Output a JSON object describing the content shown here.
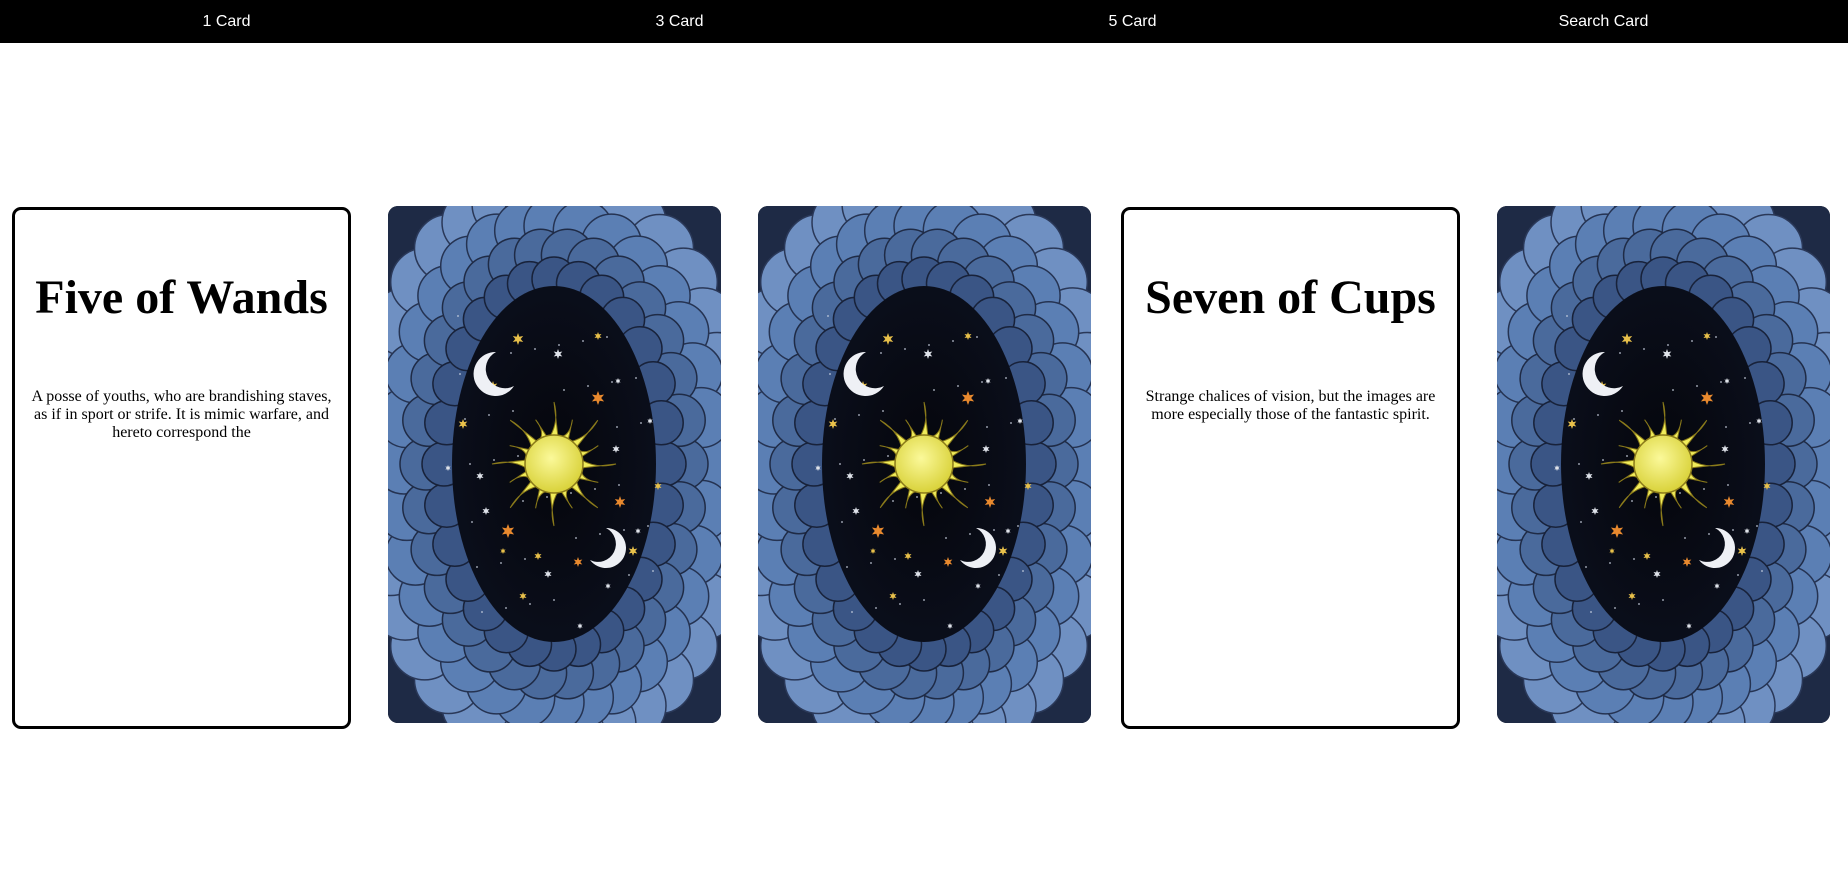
{
  "nav": {
    "items": [
      {
        "label": "1 Card"
      },
      {
        "label": "3 Card"
      },
      {
        "label": "5 Card"
      },
      {
        "label": "Search Card"
      }
    ]
  },
  "spread": {
    "cards": [
      {
        "state": "face-up",
        "title": "Five of Wands",
        "text": "A posse of youths, who are brandishing staves, as if in sport or strife. It is mimic warfare, and hereto correspond the"
      },
      {
        "state": "face-down",
        "icon": "sun-moon-stars-icon"
      },
      {
        "state": "face-down",
        "icon": "sun-moon-stars-icon"
      },
      {
        "state": "face-up",
        "title": "Seven of Cups",
        "text": "Strange chalices of vision, but the images are more especially those of the fantastic spirit."
      },
      {
        "state": "face-down",
        "icon": "sun-moon-stars-icon"
      }
    ]
  },
  "colors": {
    "nav_bg": "#000000",
    "nav_text": "#ffffff",
    "cloud_blue": "#5b7fb4",
    "night_sky": "#05060c",
    "sun_yellow": "#f0ec5a",
    "star_orange": "#e8892e"
  }
}
